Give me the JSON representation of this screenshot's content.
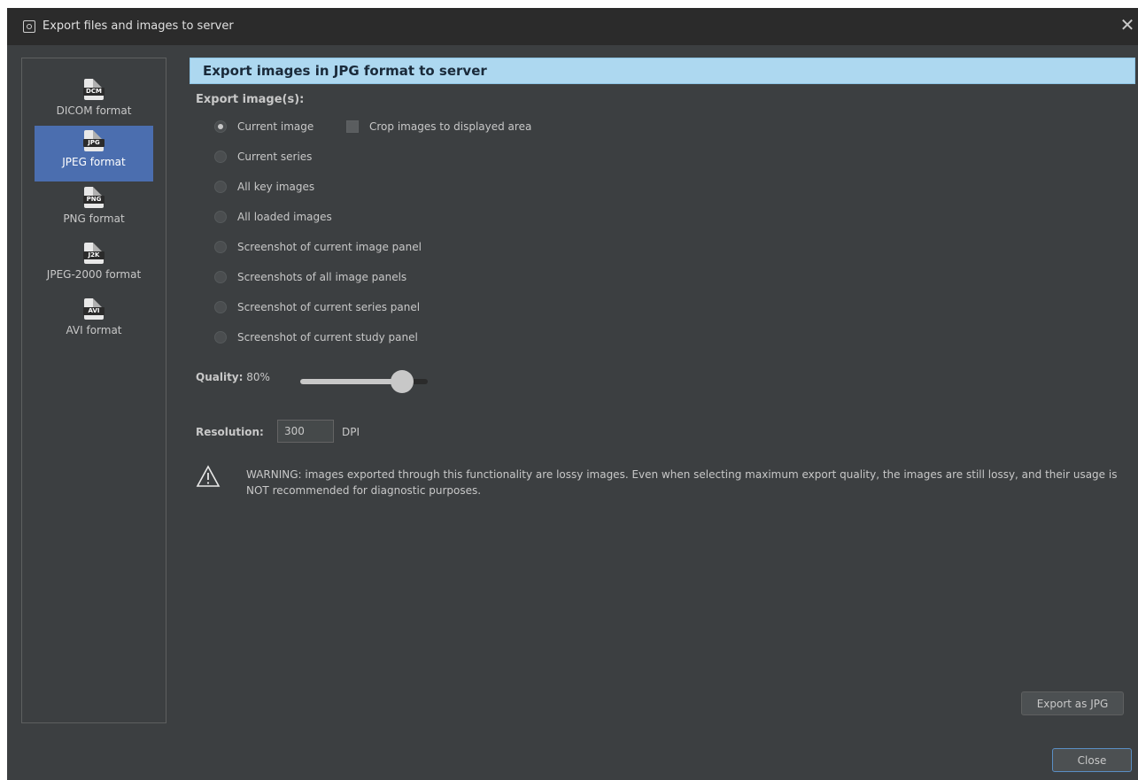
{
  "window": {
    "title": "Export files and images to server",
    "close_glyph": "✕"
  },
  "sidebar": {
    "items": [
      {
        "label": "DICOM format",
        "tag": "DCM",
        "icon": "dicom-file-icon",
        "selected": false
      },
      {
        "label": "JPEG format",
        "tag": "JPG",
        "icon": "jpeg-file-icon",
        "selected": true
      },
      {
        "label": "PNG format",
        "tag": "PNG",
        "icon": "png-file-icon",
        "selected": false
      },
      {
        "label": "JPEG-2000 format",
        "tag": "J2K",
        "icon": "j2k-file-icon",
        "selected": false
      },
      {
        "label": "AVI format",
        "tag": "AVI",
        "icon": "avi-file-icon",
        "selected": false
      }
    ]
  },
  "main": {
    "header": "Export images in JPG format to server",
    "export_label": "Export image(s):",
    "options": [
      {
        "label": "Current image",
        "checked": true
      },
      {
        "label": "Current series",
        "checked": false
      },
      {
        "label": "All key images",
        "checked": false
      },
      {
        "label": "All loaded images",
        "checked": false
      },
      {
        "label": "Screenshot of current image panel",
        "checked": false
      },
      {
        "label": "Screenshots of all image panels",
        "checked": false
      },
      {
        "label": "Screenshot of current series panel",
        "checked": false
      },
      {
        "label": "Screenshot of current study panel",
        "checked": false
      }
    ],
    "crop_label": "Crop images to displayed area",
    "crop_checked": false,
    "quality_label": "Quality:",
    "quality_value": "80%",
    "quality_percent": 80,
    "resolution_label": "Resolution:",
    "resolution_value": "300",
    "resolution_unit": "DPI",
    "warning_icon": "warning-triangle-icon",
    "warning_text": "WARNING: images exported through this functionality are lossy images. Even when selecting maximum export quality, the images are still lossy, and their usage is NOT recommended for diagnostic purposes.",
    "export_button": "Export as JPG"
  },
  "footer": {
    "close_button": "Close"
  },
  "colors": {
    "background": "#3c3f41",
    "titlebar": "#2b2b2b",
    "selected": "#4b6eaf",
    "header_bar": "#add8f0"
  }
}
